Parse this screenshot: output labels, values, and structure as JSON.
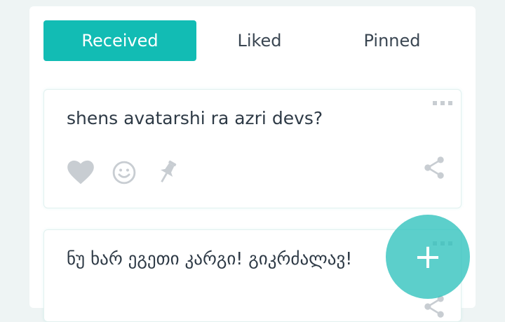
{
  "tabs": [
    {
      "label": "Received",
      "active": true
    },
    {
      "label": "Liked",
      "active": false
    },
    {
      "label": "Pinned",
      "active": false
    }
  ],
  "cards": [
    {
      "text": "shens avatarshi ra azri devs?"
    },
    {
      "text": "ნუ ხარ ეგეთი კარგი! გიკრძალავ!"
    }
  ],
  "icons": {
    "like": "heart-icon",
    "react": "smiley-icon",
    "pin": "pin-icon",
    "share": "share-icon",
    "menu": "more-dots-icon",
    "fab": "plus-icon"
  },
  "fab": {
    "label": "+"
  },
  "colors": {
    "accent": "#12bcb4",
    "fab": "#2ec2bc",
    "icon_gray": "#c8cdd2",
    "text": "#2e3a46"
  }
}
